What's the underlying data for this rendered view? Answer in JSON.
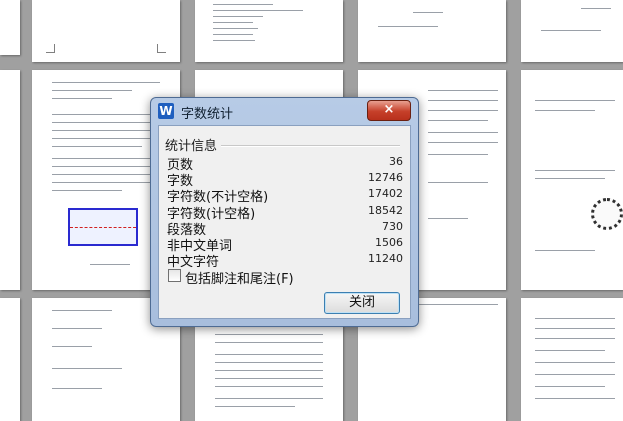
{
  "dialog": {
    "title": "字数统计",
    "logo_letter": "W",
    "close_icon": "×",
    "group_title": "统计信息",
    "stats": [
      {
        "label": "页数",
        "value": "36"
      },
      {
        "label": "字数",
        "value": "12746"
      },
      {
        "label": "字符数(不计空格)",
        "value": "17402"
      },
      {
        "label": "字符数(计空格)",
        "value": "18542"
      },
      {
        "label": "段落数",
        "value": "730"
      },
      {
        "label": "非中文单词",
        "value": "1506"
      },
      {
        "label": "中文字符",
        "value": "11240"
      }
    ],
    "checkbox_label": "包括脚注和尾注(F)",
    "checkbox_checked": false,
    "close_button_label": "关闭"
  },
  "colors": {
    "background": "#a0a0a0",
    "titlebar": "#b7cbe6",
    "close_red": "#c6402a",
    "logo_blue": "#1f5fbf"
  }
}
